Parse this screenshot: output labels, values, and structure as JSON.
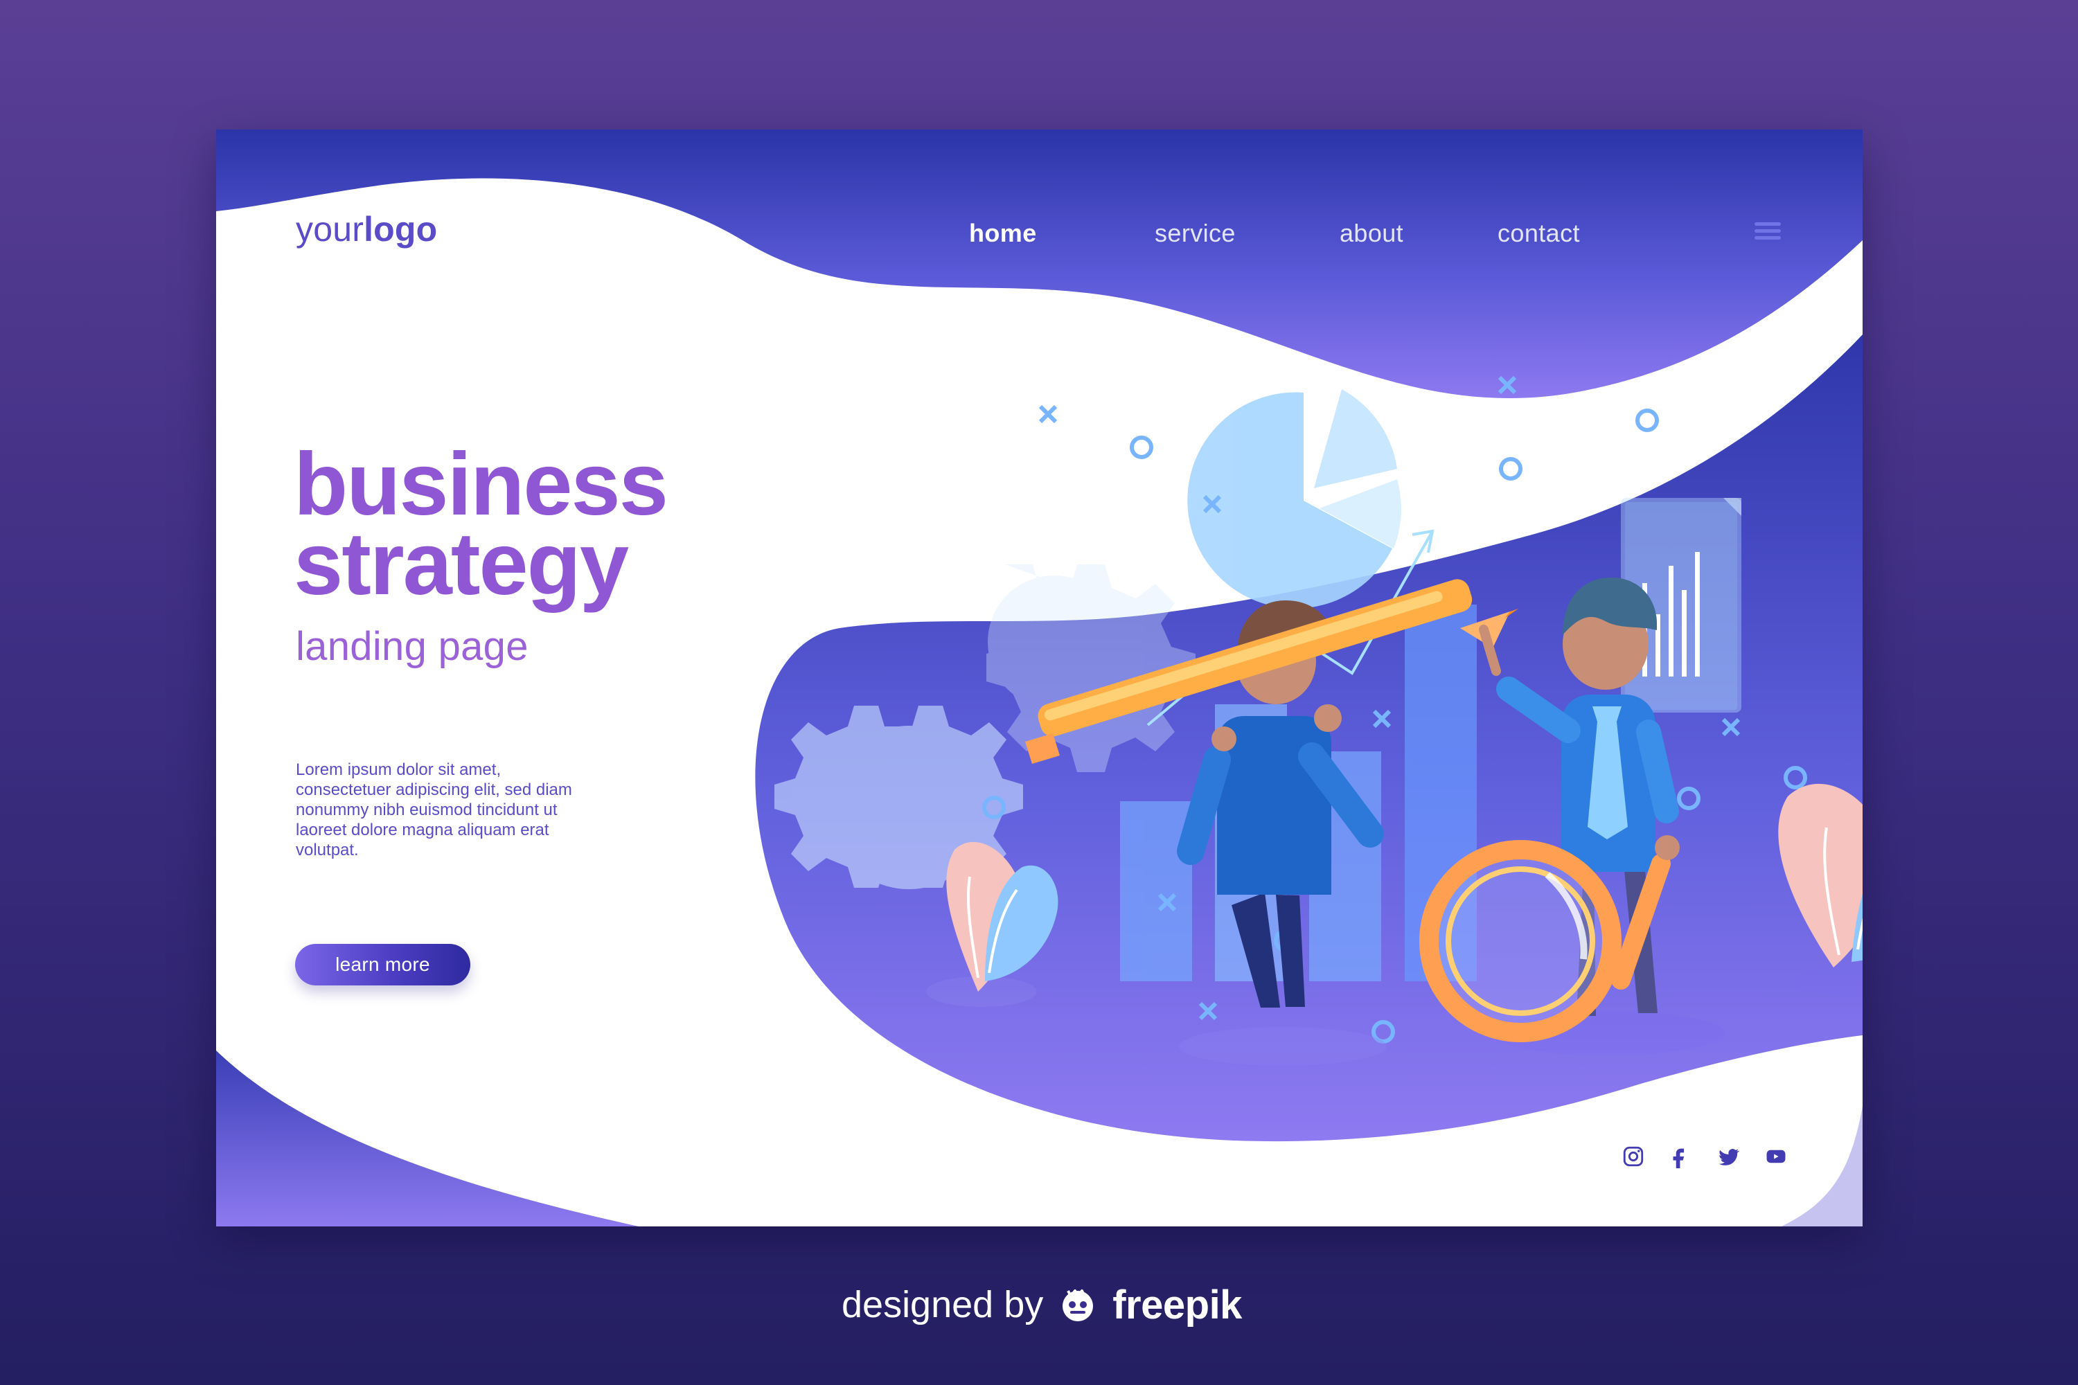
{
  "brand": {
    "logo_prefix": "your",
    "logo_suffix": "logo"
  },
  "nav": {
    "items": [
      {
        "label": "home",
        "active": true
      },
      {
        "label": "service",
        "active": false
      },
      {
        "label": "about",
        "active": false
      },
      {
        "label": "contact",
        "active": false
      }
    ],
    "menu_icon": "hamburger-icon"
  },
  "hero": {
    "title_line1": "business",
    "title_line2": "strategy",
    "subtitle": "landing page",
    "description": "Lorem ipsum dolor sit amet, consectetuer adipiscing elit, sed diam nonummy nibh euismod tincidunt ut laoreet dolore magna aliquam erat volutpat.",
    "cta_label": "learn more"
  },
  "socials": [
    {
      "name": "instagram-icon"
    },
    {
      "name": "facebook-icon"
    },
    {
      "name": "twitter-icon"
    },
    {
      "name": "youtube-icon"
    }
  ],
  "footer": {
    "credit_text": "designed by",
    "brand_name": "freepik"
  },
  "colors": {
    "accent_purple": "#8f57d4",
    "deep_purple": "#3d2f9f",
    "white": "#ffffff"
  }
}
